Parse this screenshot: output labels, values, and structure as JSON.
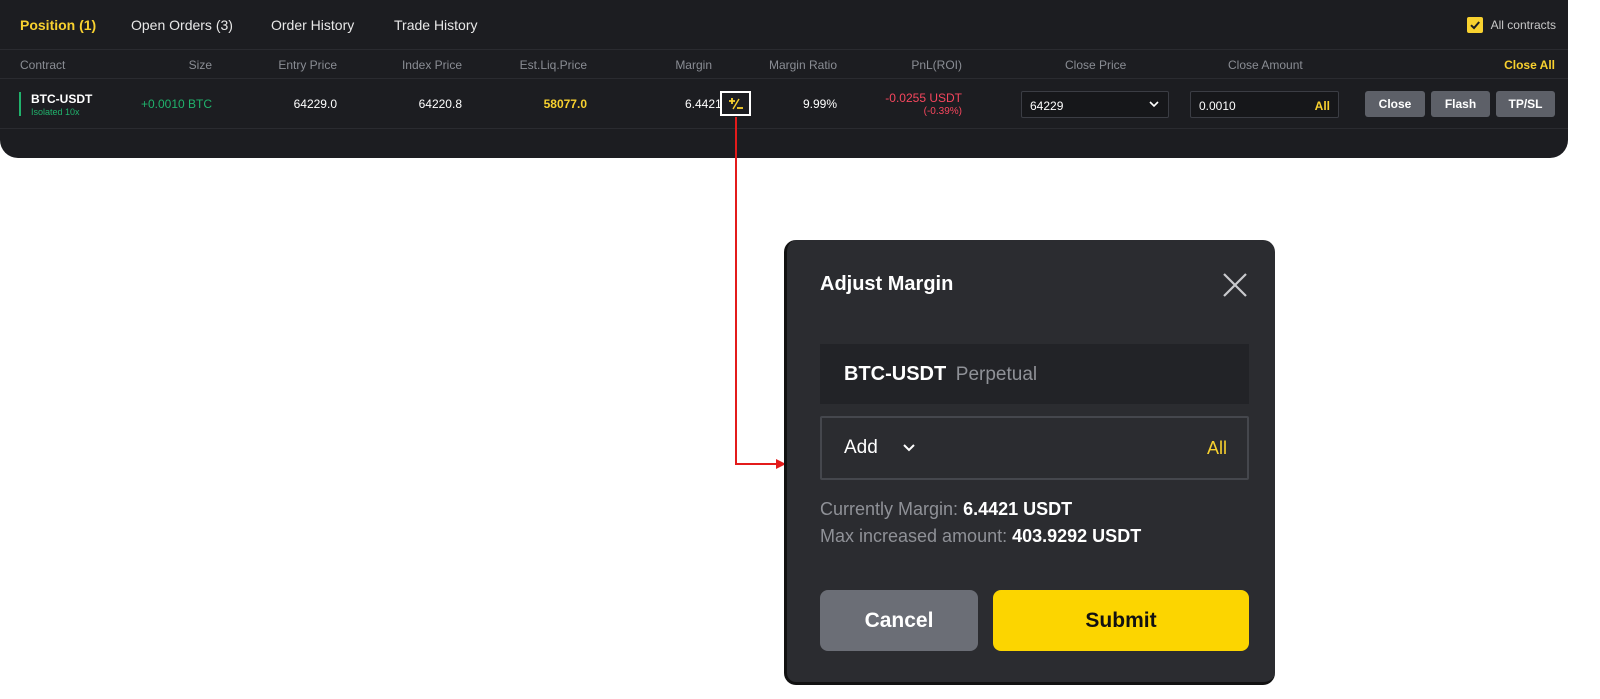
{
  "tabs": [
    {
      "label": "Position (1)",
      "active": true
    },
    {
      "label": "Open Orders (3)"
    },
    {
      "label": "Order History"
    },
    {
      "label": "Trade History"
    }
  ],
  "all_contracts": {
    "label": "All contracts",
    "checked": true
  },
  "columns": {
    "contract": "Contract",
    "size": "Size",
    "entry_price": "Entry Price",
    "index_price": "Index Price",
    "est_liq_price": "Est.Liq.Price",
    "margin": "Margin",
    "margin_ratio": "Margin Ratio",
    "pnl": "PnL(ROI)",
    "close_price": "Close Price",
    "close_amount": "Close Amount"
  },
  "close_all_label": "Close All",
  "position": {
    "symbol": "BTC-USDT",
    "leverage": "Isolated 10x",
    "size": "+0.0010 BTC",
    "entry_price": "64229.0",
    "index_price": "64220.8",
    "est_liq_price": "58077.0",
    "margin": "6.4421",
    "margin_ratio": "9.99%",
    "pnl": "-0.0255 USDT",
    "roi": "(-0.39%)",
    "close_price": "64229",
    "close_amount": "0.0010",
    "all_label": "All",
    "actions": {
      "close": "Close",
      "flash": "Flash",
      "tpsl": "TP/SL"
    }
  },
  "modal": {
    "title": "Adjust Margin",
    "pair": "BTC-USDT",
    "pair_type": "Perpetual",
    "action": "Add",
    "all_label": "All",
    "current_margin_label": "Currently Margin:",
    "current_margin_value": "6.4421 USDT",
    "max_increase_label": "Max increased amount:",
    "max_increase_value": "403.9292 USDT",
    "cancel_label": "Cancel",
    "submit_label": "Submit"
  },
  "colors": {
    "accent": "#f8d12f",
    "positive": "#20b26c",
    "negative": "#f6465d",
    "connector": "#e31b1b"
  }
}
